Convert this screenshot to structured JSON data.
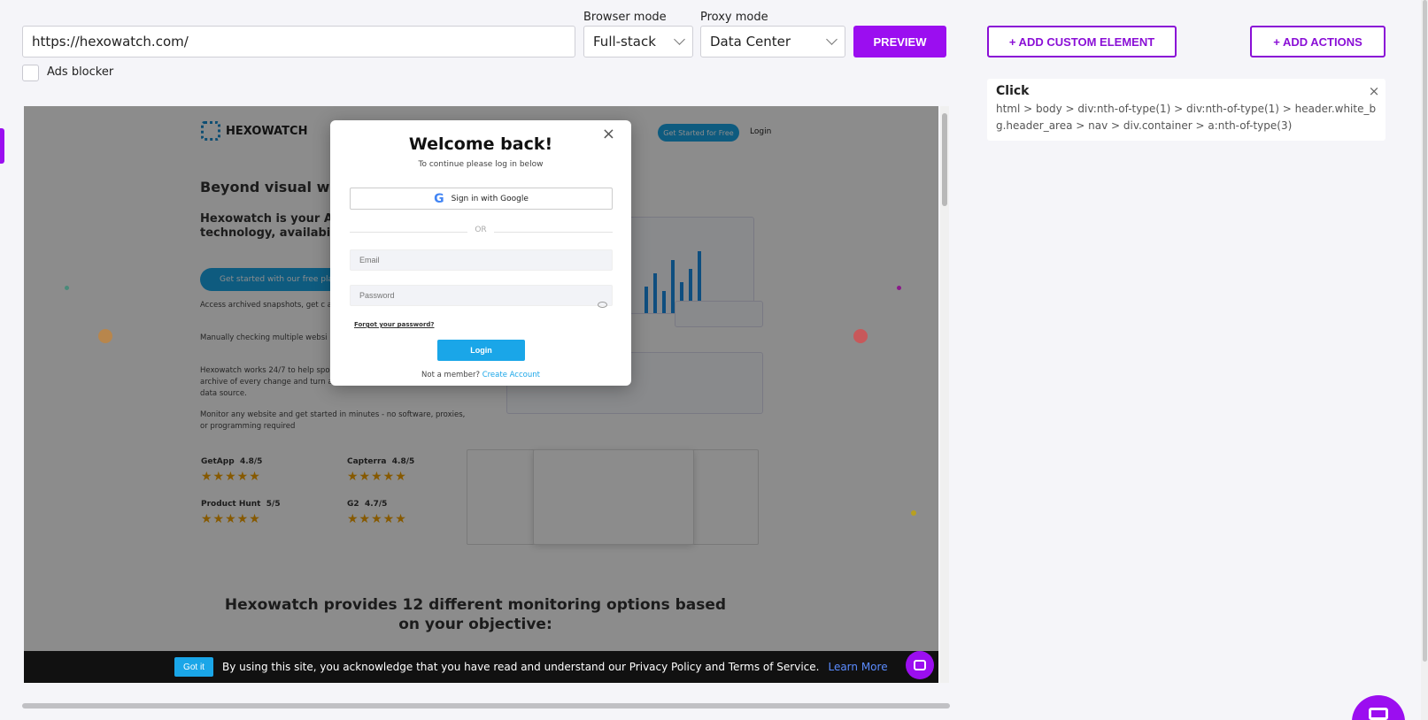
{
  "toolbar": {
    "url_value": "https://hexowatch.com/",
    "browser_mode_label": "Browser mode",
    "browser_mode_value": "Full-stack",
    "proxy_mode_label": "Proxy mode",
    "proxy_mode_value": "Data Center",
    "preview_label": "PREVIEW",
    "add_custom_element_label": "+ ADD CUSTOM ELEMENT",
    "add_actions_label": "+ ADD ACTIONS",
    "ads_blocker_label": "Ads blocker",
    "ads_blocker_checked": false
  },
  "selector_card": {
    "title": "Click",
    "path": "html > body > div:nth-of-type(1) > div:nth-of-type(1) > header.white_bg.header_area > nav > div.container > a:nth-of-type(3)"
  },
  "preview": {
    "site": {
      "logo_text": "HEXOWATCH",
      "get_started_label": "Get Started for Free",
      "login_link": "Login",
      "headline": "Beyond visual we",
      "subheadline": "Hexowatch is your AI s website for visual, con technology, availabili",
      "cta_label": "Get started with our free pla",
      "paragraphs": [
        "Access archived snapshots, get c any website in minutes.",
        "Manually checking multiple websi repetitive, and tedious.",
        "Hexowatch works 24/7 to help spo visually check your website, keep an archive of every change and turn any website into your own private data source.",
        "Monitor any website and get started in minutes - no software, proxies, or programming required"
      ],
      "ratings": [
        {
          "name": "GetApp",
          "score": "4.8/5"
        },
        {
          "name": "Capterra",
          "score": "4.8/5"
        },
        {
          "name": "Product Hunt",
          "score": "5/5"
        },
        {
          "name": "G2",
          "score": "4.7/5"
        }
      ],
      "stars": "★★★★★",
      "section_heading": "Hexowatch provides 12 different monitoring options based on your objective:"
    },
    "modal": {
      "close_glyph": "×",
      "title": "Welcome back!",
      "subtitle": "To continue please log in below",
      "google_label": "Sign in with Google",
      "google_glyph": "G",
      "or_text": "OR",
      "email_placeholder": "Email",
      "password_placeholder": "Password",
      "forgot_label": "Forgot your password?",
      "login_label": "Login",
      "member_text": "Not a member?",
      "create_account_label": "Create Account"
    },
    "cookie": {
      "got_it_label": "Got it",
      "text": "By using this site, you acknowledge that you have read and understand our Privacy Policy and Terms of Service.",
      "learn_more_label": "Learn More"
    }
  },
  "colors": {
    "accent": "#9b0ef0",
    "site_blue": "#1aa6e8",
    "star": "#f4a300"
  },
  "icons": [
    "chevron-down-icon",
    "close-icon",
    "google-icon",
    "eye-icon",
    "chat-icon",
    "star-icon"
  ]
}
